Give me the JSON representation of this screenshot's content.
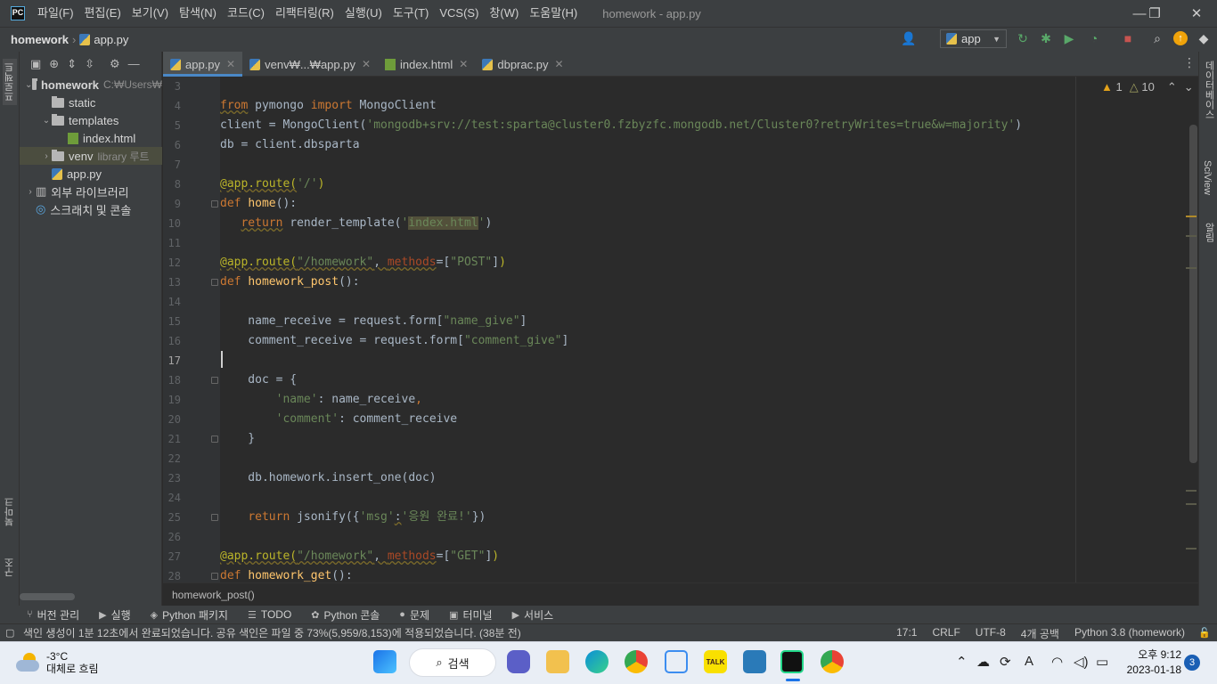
{
  "titlebar": {
    "logo": "PC",
    "menus": [
      "파일(F)",
      "편집(E)",
      "보기(V)",
      "탐색(N)",
      "코드(C)",
      "리팩터링(R)",
      "실행(U)",
      "도구(T)",
      "VCS(S)",
      "창(W)",
      "도움말(H)"
    ],
    "window_title": "homework - app.py",
    "minimize": "—",
    "maximize": "❐",
    "close": "✕"
  },
  "navbar": {
    "project": "homework",
    "file": "app.py",
    "run_config": "app"
  },
  "left_stripe": {
    "project": "프로젝트",
    "bookmarks": "북마크",
    "structure": "구조"
  },
  "right_stripe": {
    "database": "데이터베이스",
    "sciview": "SciView",
    "notifications": "알림"
  },
  "project_tree": [
    {
      "label": "homework",
      "note": "C:₩Users₩",
      "indent": 0,
      "type": "folder",
      "arrow": "down",
      "bold": true
    },
    {
      "label": "static",
      "note": "",
      "indent": 1,
      "type": "folder",
      "arrow": ""
    },
    {
      "label": "templates",
      "note": "",
      "indent": 1,
      "type": "folder",
      "arrow": "down"
    },
    {
      "label": "index.html",
      "note": "",
      "indent": 2,
      "type": "html",
      "arrow": ""
    },
    {
      "label": "venv",
      "note": "library 루트",
      "indent": 1,
      "type": "folder",
      "arrow": "right",
      "selected": true
    },
    {
      "label": "app.py",
      "note": "",
      "indent": 1,
      "type": "py",
      "arrow": ""
    },
    {
      "label": "외부 라이브러리",
      "note": "",
      "indent": 0,
      "type": "lib",
      "arrow": "right"
    },
    {
      "label": "스크래치 및 콘솔",
      "note": "",
      "indent": 0,
      "type": "scratch",
      "arrow": ""
    }
  ],
  "tabs": [
    {
      "label": "app.py",
      "active": true,
      "icon": "py"
    },
    {
      "label": "venv₩...₩app.py",
      "active": false,
      "icon": "py"
    },
    {
      "label": "index.html",
      "active": false,
      "icon": "html"
    },
    {
      "label": "dbprac.py",
      "active": false,
      "icon": "py"
    }
  ],
  "inspections": {
    "warnings": "1",
    "weak_warnings": "10"
  },
  "code_lines": [
    {
      "n": "3",
      "html": ""
    },
    {
      "n": "4",
      "html": "<span class='kw warn'>from</span> pymongo <span class='kw'>import</span> MongoClient"
    },
    {
      "n": "5",
      "html": "client = MongoClient(<span class='str'>'mongodb+srv://test:sparta@cluster0.fzbyzfc.mongodb.net/Cluster0?retryWrites=true&amp;w=majority'</span>)"
    },
    {
      "n": "6",
      "html": "db = client.dbsparta"
    },
    {
      "n": "7",
      "html": ""
    },
    {
      "n": "8",
      "html": "<span class='deco warn'>@app.route(</span><span class='str'>'/'</span><span class='deco'>)</span>"
    },
    {
      "n": "9",
      "html": "<span class='kw'>def</span> <span class='fn'>home</span>():"
    },
    {
      "n": "10",
      "html": "   <span class='kw warn'>return</span> render_template(<span class='str'>'<span class=\"hl\">index.html</span>'</span>)"
    },
    {
      "n": "11",
      "html": ""
    },
    {
      "n": "12",
      "html": "<span class='deco warn'>@app.route(</span><span class='str warn'>\"/homework\"</span><span class='warn'>, </span><span class='par warn'>methods</span>=[<span class='str'>\"POST\"</span>]<span class='deco'>)</span>"
    },
    {
      "n": "13",
      "html": "<span class='kw'>def</span> <span class='fn'>homework_post</span>():"
    },
    {
      "n": "14",
      "html": ""
    },
    {
      "n": "15",
      "html": "    name_receive = request.form[<span class='str'>\"name_give\"</span>]"
    },
    {
      "n": "16",
      "html": "    comment_receive = request.form[<span class='str'>\"comment_give\"</span>]"
    },
    {
      "n": "17",
      "html": ""
    },
    {
      "n": "18",
      "html": "    doc = {"
    },
    {
      "n": "19",
      "html": "        <span class='str'>'name'</span>: name_receive<span class='kw'>,</span>"
    },
    {
      "n": "20",
      "html": "        <span class='str'>'comment'</span>: comment_receive"
    },
    {
      "n": "21",
      "html": "    }"
    },
    {
      "n": "22",
      "html": ""
    },
    {
      "n": "23",
      "html": "    db.homework.insert_one(doc)"
    },
    {
      "n": "24",
      "html": ""
    },
    {
      "n": "25",
      "html": "    <span class='kw'>return</span> jsonify({<span class='str'>'msg'</span><span class='warn'>:</span><span class='str'>'응원 완료!'</span>})"
    },
    {
      "n": "26",
      "html": ""
    },
    {
      "n": "27",
      "html": "<span class='deco warn'>@app.route(</span><span class='str warn'>\"/homework\"</span><span class='warn'>, </span><span class='par warn'>methods</span>=[<span class='str'>\"GET\"</span>]<span class='deco'>)</span>"
    },
    {
      "n": "28",
      "html": "<span class='kw'>def</span> <span class='fn'>homework_get</span>():"
    }
  ],
  "method_breadcrumb": "homework_post()",
  "tool_windows": [
    {
      "icon": "vcs-icon",
      "glyph": "⑂",
      "label": "버전 관리"
    },
    {
      "icon": "run-icon",
      "glyph": "▶",
      "label": "실행"
    },
    {
      "icon": "packages-icon",
      "glyph": "◈",
      "label": "Python 패키지"
    },
    {
      "icon": "todo-icon",
      "glyph": "☰",
      "label": "TODO"
    },
    {
      "icon": "python-console-icon",
      "glyph": "✿",
      "label": "Python 콘솔"
    },
    {
      "icon": "problems-icon",
      "glyph": "●",
      "label": "문제"
    },
    {
      "icon": "terminal-icon",
      "glyph": "▣",
      "label": "터미널"
    },
    {
      "icon": "services-icon",
      "glyph": "▶",
      "label": "서비스"
    }
  ],
  "status": {
    "message": "색인 생성이 1분 12초에서 완료되었습니다. 공유 색인은 파일 중 73%(5,959/8,153)에 적용되었습니다. (38분 전)",
    "position": "17:1",
    "line_sep": "CRLF",
    "encoding": "UTF-8",
    "indent": "4개 공백",
    "interpreter": "Python 3.8 (homework)"
  },
  "taskbar": {
    "temp": "-3°C",
    "weather": "대체로 흐림",
    "search": "검색",
    "time": "오후 9:12",
    "date": "2023-01-18",
    "notifications": "3",
    "ime": "A"
  },
  "colors": {
    "accent": "#4a88c7",
    "keyword": "#cc7832",
    "string": "#6a8759",
    "decorator": "#bbb529",
    "function": "#ffc66d"
  }
}
